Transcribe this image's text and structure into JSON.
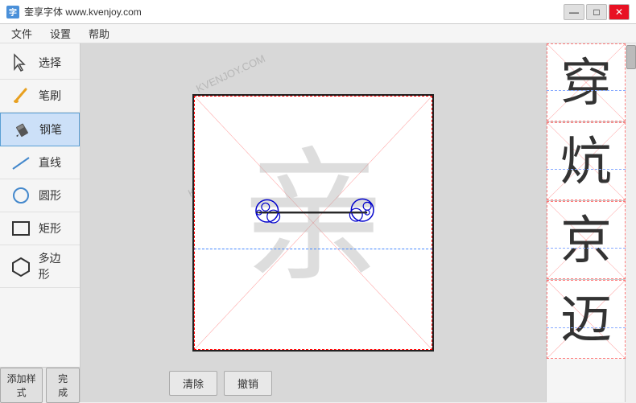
{
  "window": {
    "title": "奎享字体 www.kvenjoy.com",
    "icon_label": "字"
  },
  "titlebar": {
    "minimize_label": "—",
    "maximize_label": "□",
    "close_label": "✕"
  },
  "menu": {
    "items": [
      "文件",
      "设置",
      "帮助"
    ]
  },
  "toolbar": {
    "tools": [
      {
        "id": "select",
        "label": "选择"
      },
      {
        "id": "brush",
        "label": "笔刷"
      },
      {
        "id": "pen",
        "label": "钢笔",
        "active": true
      },
      {
        "id": "line",
        "label": "直线"
      },
      {
        "id": "circle",
        "label": "圆形"
      },
      {
        "id": "rect",
        "label": "矩形"
      },
      {
        "id": "polygon",
        "label": "多边形"
      }
    ],
    "bottom_buttons": [
      {
        "id": "add-style",
        "label": "添加样式"
      },
      {
        "id": "done",
        "label": "完成"
      }
    ]
  },
  "canvas": {
    "ghost_char": "亲",
    "watermark": "KVENJOY.COM"
  },
  "action_buttons": [
    {
      "id": "clear",
      "label": "清除"
    },
    {
      "id": "undo",
      "label": "撤销"
    }
  ],
  "right_panel": {
    "chars": [
      "穿",
      "炕",
      "京",
      "迈"
    ]
  }
}
